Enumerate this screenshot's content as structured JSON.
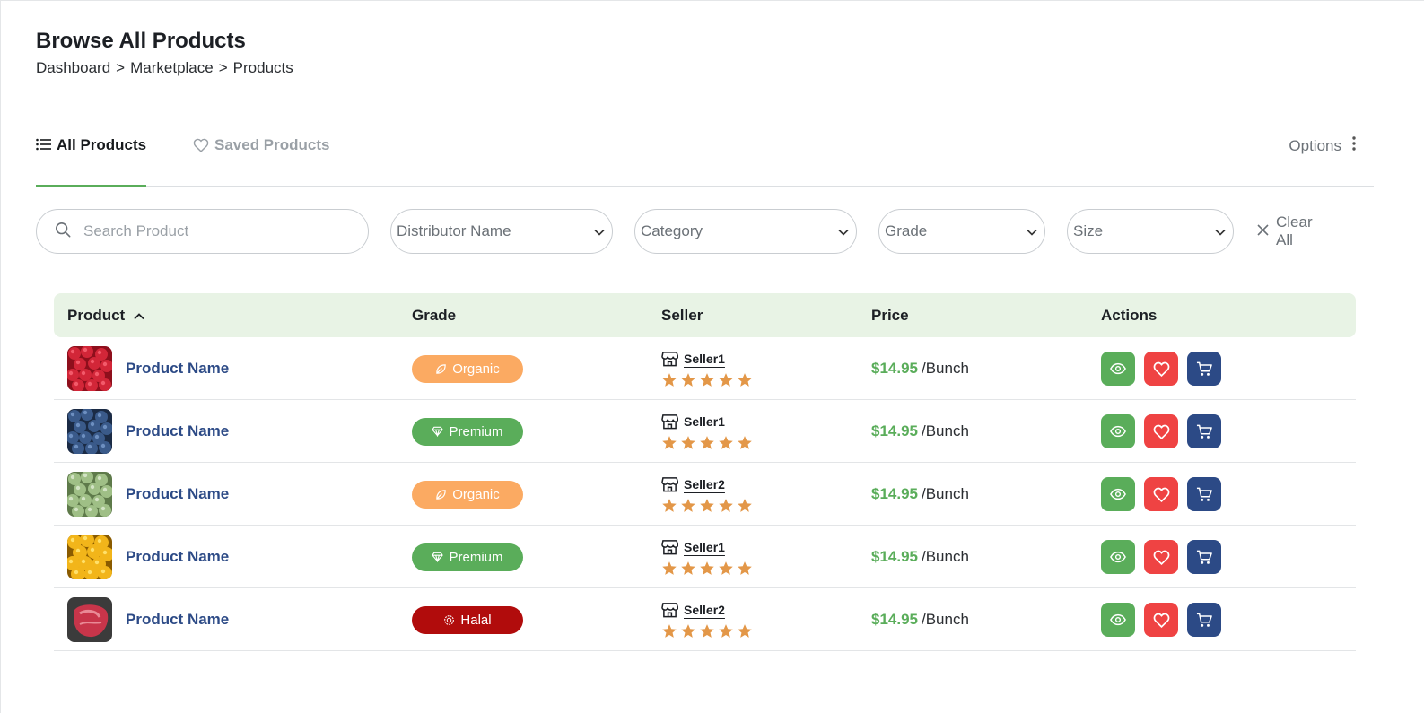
{
  "header": {
    "title": "Browse All Products",
    "breadcrumb": [
      "Dashboard",
      "Marketplace",
      "Products"
    ],
    "breadcrumb_separator": ">"
  },
  "tabs": {
    "all_label": "All Products",
    "saved_label": "Saved Products",
    "options_label": "Options"
  },
  "filters": {
    "search_placeholder": "Search Product",
    "distributor_label": "Distributor Name",
    "category_label": "Category",
    "grade_label": "Grade",
    "size_label": "Size",
    "clear_all_label": "Clear All"
  },
  "table": {
    "columns": {
      "product": "Product",
      "grade": "Grade",
      "seller": "Seller",
      "price": "Price",
      "actions": "Actions"
    },
    "sort": {
      "column": "product",
      "direction": "ascending"
    },
    "rows": [
      {
        "image": "cranberries",
        "name": "Product Name",
        "grade": "Organic",
        "grade_icon": "leaf-icon",
        "grade_color": "#fbaa62",
        "seller": "Seller1",
        "rating": 5,
        "price": "$14.95",
        "unit": "/Bunch"
      },
      {
        "image": "blueberries",
        "name": "Product Name",
        "grade": "Premium",
        "grade_icon": "diamond-icon",
        "grade_color": "#5aad5a",
        "seller": "Seller1",
        "rating": 5,
        "price": "$14.95",
        "unit": "/Bunch"
      },
      {
        "image": "broccoli",
        "name": "Product Name",
        "grade": "Organic",
        "grade_icon": "leaf-icon",
        "grade_color": "#fbaa62",
        "seller": "Seller2",
        "rating": 5,
        "price": "$14.95",
        "unit": "/Bunch"
      },
      {
        "image": "lemons",
        "name": "Product Name",
        "grade": "Premium",
        "grade_icon": "diamond-icon",
        "grade_color": "#5aad5a",
        "seller": "Seller1",
        "rating": 5,
        "price": "$14.95",
        "unit": "/Bunch"
      },
      {
        "image": "raw-meat",
        "name": "Product Name",
        "grade": "Halal",
        "grade_icon": "halal-seal-icon",
        "grade_color": "#b10c0c",
        "seller": "Seller2",
        "rating": 5,
        "price": "$14.95",
        "unit": "/Bunch"
      }
    ]
  },
  "colors": {
    "accent_green": "#5aad5a",
    "favorite_red": "#ef4343",
    "cart_navy": "#2c4a86",
    "header_bg": "#e8f3e5",
    "star": "#e39748",
    "product_link": "#2c4a86"
  },
  "icons": {
    "view": "eye-icon",
    "favorite": "heart-icon",
    "cart": "cart-icon",
    "store": "store-icon",
    "rating": "star-icon"
  }
}
